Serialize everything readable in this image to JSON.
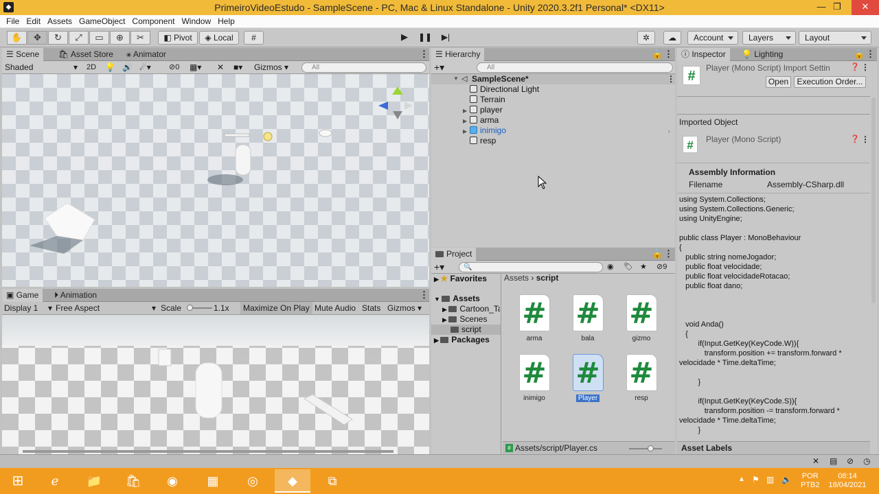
{
  "window": {
    "title": "PrimeiroVideoEstudo - SampleScene - PC, Mac & Linux Standalone - Unity 2020.3.2f1 Personal* <DX11>",
    "min": "—",
    "max": "❐",
    "close": "✕"
  },
  "menu": [
    "File",
    "Edit",
    "Assets",
    "GameObject",
    "Component",
    "Window",
    "Help"
  ],
  "toolbar": {
    "pivot": "Pivot",
    "local": "Local",
    "account": "Account",
    "layers": "Layers",
    "layout": "Layout"
  },
  "scene": {
    "tabs": [
      "Scene",
      "Asset Store",
      "Animator"
    ],
    "shading": "Shaded",
    "mode_2d": "2D",
    "hidden_count": "0",
    "gizmos": "Gizmos",
    "search_placeholder": "All"
  },
  "game": {
    "tabs": [
      "Game",
      "Animation"
    ],
    "display": "Display 1",
    "aspect": "Free Aspect",
    "scale_label": "Scale",
    "scale_value": "1.1x",
    "maximize": "Maximize On Play",
    "mute": "Mute Audio",
    "stats": "Stats",
    "gizmos": "Gizmos"
  },
  "hierarchy": {
    "tab": "Hierarchy",
    "search_placeholder": "All",
    "scene_name": "SampleScene*",
    "items": [
      "Directional Light",
      "Terrain",
      "player",
      "arma",
      "inimigo",
      "resp"
    ]
  },
  "project": {
    "tab": "Project",
    "hidden_count": "9",
    "breadcrumb": [
      "Assets",
      "script"
    ],
    "favorites": "Favorites",
    "tree": {
      "assets": "Assets",
      "cartoon": "Cartoon_Ta",
      "scenes": "Scenes",
      "script": "script",
      "packages": "Packages"
    },
    "assets": [
      "arma",
      "bala",
      "gizmo",
      "inimigo",
      "Player",
      "resp"
    ],
    "path": "Assets/script/Player.cs"
  },
  "inspector": {
    "tabs": [
      "Inspector",
      "Lighting"
    ],
    "header_title": "Player (Mono Script) Import Settin",
    "open": "Open",
    "exec_order": "Execution Order...",
    "imported_object": "Imported Object",
    "object_title": "Player (Mono Script)",
    "assembly_info": "Assembly Information",
    "filename_label": "Filename",
    "filename_value": "Assembly-CSharp.dll",
    "code": "using System.Collections;\nusing System.Collections.Generic;\nusing UnityEngine;\n\npublic class Player : MonoBehaviour\n{\n   public string nomeJogador;\n   public float velocidade;\n   public float velocidadeRotacao;\n   public float dano;\n\n\n\n   void Anda()\n   {\n         if(Input.GetKey(KeyCode.W)){\n            transform.position += transform.forward *\nvelocidade * Time.deltaTime;\n\n         }\n\n         if(Input.GetKey(KeyCode.S)){\n            transform.position -= transform.forward *\nvelocidade * Time.deltaTime;\n         }",
    "asset_labels": "Asset Labels"
  },
  "taskbar": {
    "lang": "POR",
    "layout": "PTB2",
    "time": "08:14",
    "date": "18/04/2021"
  }
}
